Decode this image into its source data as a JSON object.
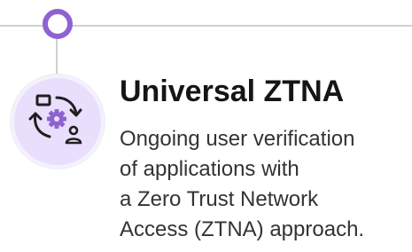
{
  "card": {
    "title": "Universal ZTNA",
    "description_lines": [
      "Ongoing user verification",
      "of applications with",
      "a Zero Trust Network",
      "Access (ZTNA) approach."
    ],
    "icon": "user-app-verification-cycle-icon"
  },
  "colors": {
    "accent": "#8e63d1",
    "badge_bg": "#e9defb",
    "timeline": "#d0d0d0"
  }
}
